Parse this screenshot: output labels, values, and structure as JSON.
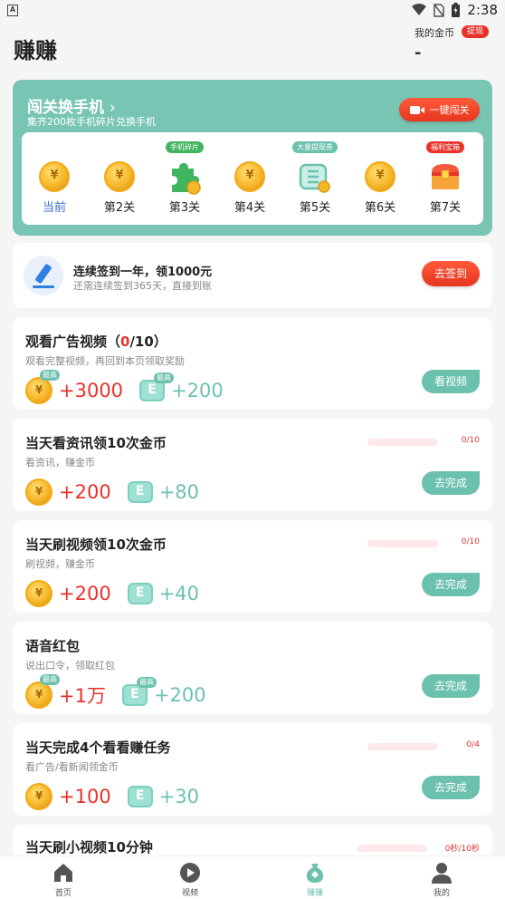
{
  "status_bar": {
    "time": "2:38",
    "a_badge": "A"
  },
  "header": {
    "title": "赚赚",
    "coin_label": "我的金币",
    "withdraw_label": "提现",
    "coin_value": "-"
  },
  "level_card": {
    "title": "闯关换手机",
    "subtitle": "集齐200枚手机碎片兑换手机",
    "button_label": "一键闯关",
    "levels": [
      {
        "label": "当前",
        "icon": "coin-icon",
        "tag": ""
      },
      {
        "label": "第2关",
        "icon": "coin-icon",
        "tag": ""
      },
      {
        "label": "第3关",
        "icon": "puzzle-icon",
        "tag": "手机碎片"
      },
      {
        "label": "第4关",
        "icon": "coin-icon",
        "tag": ""
      },
      {
        "label": "第5关",
        "icon": "ticket-icon",
        "tag": "大量提现券"
      },
      {
        "label": "第6关",
        "icon": "coin-icon",
        "tag": ""
      },
      {
        "label": "第7关",
        "icon": "treasure-chest-icon",
        "tag": "福利宝箱"
      }
    ],
    "colors": {
      "card": "#79c5b4",
      "tag_green": "#3fb55f",
      "tag_teal": "#6cc1ae",
      "tag_red": "#e8322a"
    }
  },
  "signin": {
    "title": "连续签到一年，领1000元",
    "subtitle": "还需连续签到365天，直接到账",
    "button_label": "去签到"
  },
  "tasks": [
    {
      "title": "观看广告视频（",
      "count_current": "0",
      "count_rest": "/10）",
      "subtitle": "观看完整视频，再回到本页领取奖励",
      "coin_amount": "+3000",
      "ticket_amount": "+200",
      "max_tag": "最高",
      "button_label": "看视频",
      "progress_text": "",
      "progress": null
    },
    {
      "title": "当天看资讯领10次金币",
      "subtitle": "看资讯，赚金币",
      "coin_amount": "+200",
      "ticket_amount": "+80",
      "max_tag": "",
      "button_label": "去完成",
      "progress_text": "0/10",
      "progress": 0
    },
    {
      "title": "当天刷视频领10次金币",
      "subtitle": "刷视频，赚金币",
      "coin_amount": "+200",
      "ticket_amount": "+40",
      "max_tag": "",
      "button_label": "去完成",
      "progress_text": "0/10",
      "progress": 0
    },
    {
      "title": "语音红包",
      "subtitle": "说出口令，领取红包",
      "coin_amount": "+1万",
      "ticket_amount": "+200",
      "max_tag": "最高",
      "button_label": "去完成",
      "progress_text": "",
      "progress": null
    },
    {
      "title": "当天完成4个看看赚任务",
      "subtitle": "看广告/看新闻领金币",
      "coin_amount": "+100",
      "ticket_amount": "+30",
      "max_tag": "",
      "button_label": "去完成",
      "progress_text": "0/4",
      "progress": 0
    },
    {
      "title": "当天刷小视频10分钟",
      "subtitle": "",
      "coin_amount": "",
      "ticket_amount": "",
      "max_tag": "",
      "button_label": "",
      "progress_text": "0秒/10秒",
      "progress": 0
    }
  ],
  "bottom_nav": [
    {
      "label": "首页",
      "icon": "home-icon"
    },
    {
      "label": "视频",
      "icon": "play-icon"
    },
    {
      "label": "赚赚",
      "icon": "money-bag-icon",
      "active": true
    },
    {
      "label": "我的",
      "icon": "user-icon"
    }
  ]
}
